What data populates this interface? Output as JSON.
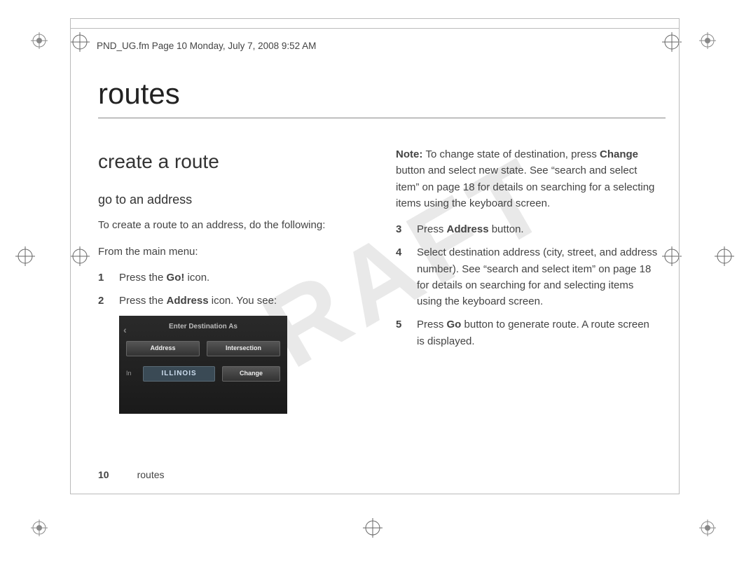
{
  "watermark": "DRAFT",
  "header_meta": "PND_UG.fm  Page 10  Monday, July 7, 2008  9:52 AM",
  "title": "routes",
  "left": {
    "section": "create a route",
    "sub": "go to an address",
    "intro": "To create a route to an address, do the following:",
    "lead": "From the main menu:",
    "steps": {
      "s1_num": "1",
      "s1_a": "Press the ",
      "s1_b": "Go!",
      "s1_c": " icon.",
      "s2_num": "2",
      "s2_a": "Press the ",
      "s2_b": "Address",
      "s2_c": " icon. You see:"
    }
  },
  "screenshot": {
    "title": "Enter Destination As",
    "address": "Address",
    "intersection": "Intersection",
    "in_label": "In",
    "state": "ILLINOIS",
    "change": "Change"
  },
  "right": {
    "note_label": "Note: ",
    "note_a": "To change state of destination, press ",
    "note_b": "Change",
    "note_c": " button and select new state. See “search and select item” on page 18 for details on searching for a selecting items using the keyboard screen.",
    "s3_num": "3",
    "s3_a": "Press ",
    "s3_b": "Address",
    "s3_c": " button.",
    "s4_num": "4",
    "s4": "Select destination address (city, street, and address number). See “search and select item” on page 18 for details on searching for and selecting items using the keyboard screen.",
    "s5_num": "5",
    "s5_a": "Press ",
    "s5_b": "Go",
    "s5_c": " button to generate route. A route screen is displayed."
  },
  "footer": {
    "page": "10",
    "section": "routes"
  }
}
